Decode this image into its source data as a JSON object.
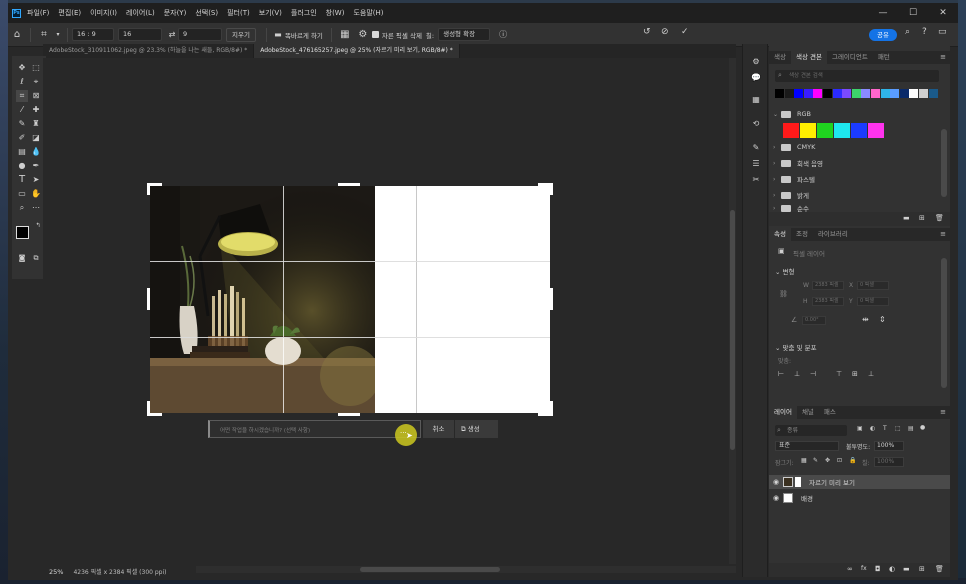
{
  "menubar": {
    "logo": "Ps",
    "items": [
      "파일(F)",
      "편집(E)",
      "이미지(I)",
      "레이어(L)",
      "문자(Y)",
      "선택(S)",
      "필터(T)",
      "보기(V)",
      "플러그인",
      "창(W)",
      "도움말(H)"
    ],
    "window_controls": [
      "—",
      "☐",
      "✕"
    ]
  },
  "options": {
    "ratio": "16 : 9",
    "width": "16",
    "height": "9",
    "clear_label": "지우기",
    "straighten_label": "똑바르게 하기",
    "delete_crop_label": "자른 픽셀 삭제",
    "fill_label": "칠:",
    "fill_value": "생성형 확장",
    "share_label": "공유"
  },
  "tabs": [
    {
      "label": "AdobeStock_310911062.jpeg @ 23.3% (하늘을 나는 새들, RGB/8#) *",
      "active": false
    },
    {
      "label": "AdobeStock_476165257.jpeg @ 25% (자르기 미리 보기, RGB/8#) *",
      "active": true
    }
  ],
  "status": {
    "zoom": "25%",
    "doc_info": "4236 픽셀 x 2384 픽셀 (300 ppi)"
  },
  "gen_bar": {
    "placeholder": "어떤 작업을 하시겠습니까? (선택 사항)",
    "more": "···",
    "cancel": "취소",
    "generate": "생성"
  },
  "swatches_panel": {
    "tabs": [
      "색상",
      "색상 견본",
      "그레이디언트",
      "패턴"
    ],
    "active_tab": 1,
    "search_placeholder": "색상 견본 검색",
    "recent_colors": [
      "#000000",
      "#1a1a1a",
      "#0000ff",
      "#3a1cff",
      "#ff00ff",
      "#000000",
      "#2b2bff",
      "#7b4aff",
      "#3dd36b",
      "#8a8aff",
      "#ff66cc",
      "#2fb5e8",
      "#5a9cff",
      "#0a2a6a",
      "#ffffff",
      "#cfcfcf",
      "#1a5a8a"
    ],
    "groups": [
      "RGB",
      "CMYK",
      "회색 음영",
      "파스텔",
      "밝게",
      "순수"
    ],
    "rgb_colors": [
      "#ff1a1a",
      "#ffee00",
      "#1fd41f",
      "#1ee7ee",
      "#1b3bff",
      "#ff33ee"
    ]
  },
  "properties_panel": {
    "tabs": [
      "속성",
      "조정",
      "라이브러리"
    ],
    "active_tab": 0,
    "type_label": "픽셀 레이어",
    "transform_heading": "변형",
    "w_label": "W",
    "w_value": "2383 픽셀",
    "x_label": "X",
    "x_value": "0 픽셀",
    "h_label": "H",
    "h_value": "2383 픽셀",
    "y_label": "Y",
    "y_value": "0 픽셀",
    "angle_value": "0.00°",
    "align_heading": "맞춤 및 분포",
    "align_label": "맞춤:"
  },
  "layers_panel": {
    "tabs": [
      "레이어",
      "채널",
      "패스"
    ],
    "active_tab": 0,
    "search_placeholder": "종류",
    "blend_mode": "표준",
    "opacity_label": "불투명도:",
    "opacity_value": "100%",
    "lock_label": "잠그기:",
    "fill_label": "칠:",
    "fill_value": "100%",
    "layers": [
      {
        "name": "자르기 미리 보기",
        "selected": true
      },
      {
        "name": "배경",
        "selected": false
      }
    ]
  }
}
